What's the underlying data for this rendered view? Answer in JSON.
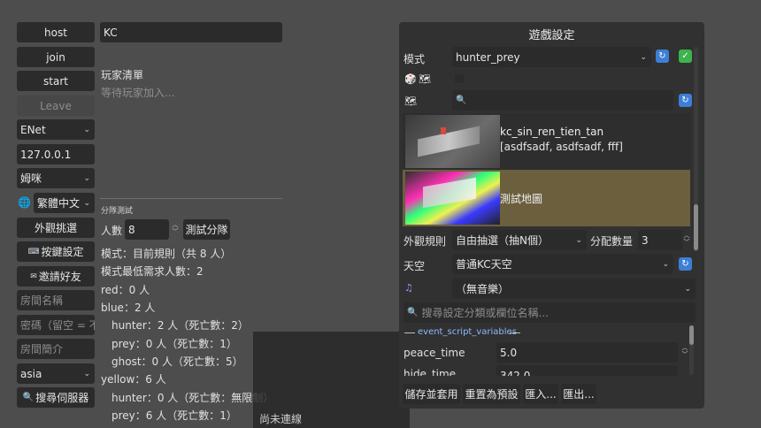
{
  "left": {
    "host_label": "host",
    "join_label": "join",
    "start_label": "start",
    "leave_label": "Leave",
    "network_select": "ENet",
    "ip_value": "127.0.0.1",
    "name_select": "姆咪",
    "language_select": "繁體中文",
    "appearance_label": "外觀挑選",
    "keybind_label": "按鍵設定",
    "invite_label": "邀請好友",
    "room_name_placeholder": "房間名稱",
    "password_placeholder": "密碼（留空 = 不",
    "room_desc_placeholder": "房間簡介",
    "region_select": "asia",
    "search_server_label": "搜尋伺服器"
  },
  "middle": {
    "name_value": "KC",
    "player_list_title": "玩家清單",
    "waiting_text": "等待玩家加入...",
    "team_test_title": "分隊測試",
    "count_label": "人數",
    "count_value": "8",
    "test_split_label": "測試分隊",
    "lines": [
      "模式：目前規則（共 8 人）",
      "模式最低需求人數：2",
      "red：0 人",
      "blue：2 人",
      "hunter：2 人（死亡數：2）",
      "prey：0 人（死亡數：1）",
      "ghost：0 人（死亡數：5）",
      "yellow：6 人",
      "hunter：0 人（死亡數：無限制）",
      "prey：6 人（死亡數：1）"
    ],
    "status_text": "尚未連線"
  },
  "panel": {
    "title": "遊戲設定",
    "mode_label": "模式",
    "mode_value": "hunter_prey",
    "map_search_value": "",
    "maps": [
      {
        "name": "kc_sin_ren_tien_tan",
        "tags": "[asdfsadf, asdfsadf, fff]"
      },
      {
        "name": "測試地圖",
        "tags": ""
      }
    ],
    "appearance_rule_label": "外觀規則",
    "appearance_rule_value": "自由抽選（抽N個）",
    "alloc_label": "分配數量",
    "alloc_value": "3",
    "sky_label": "天空",
    "sky_value": "普通KC天空",
    "music_value": "（無音樂）",
    "search_settings_placeholder": "搜尋設定分類或欄位名稱...",
    "section_title": "event_script_variables",
    "vars": [
      {
        "name": "peace_time",
        "value": "5.0"
      },
      {
        "name": "hide_time",
        "value": "342.0"
      }
    ],
    "save_label": "儲存並套用",
    "reset_label": "重置為預設",
    "import_label": "匯入...",
    "export_label": "匯出..."
  },
  "colors": {
    "background": "#4d4d4d",
    "panel": "#313131",
    "field": "#2b2b2b",
    "selected_map": "#6b5f3e",
    "accent_blue": "#3d7fd6",
    "accent_green": "#3db34d"
  }
}
